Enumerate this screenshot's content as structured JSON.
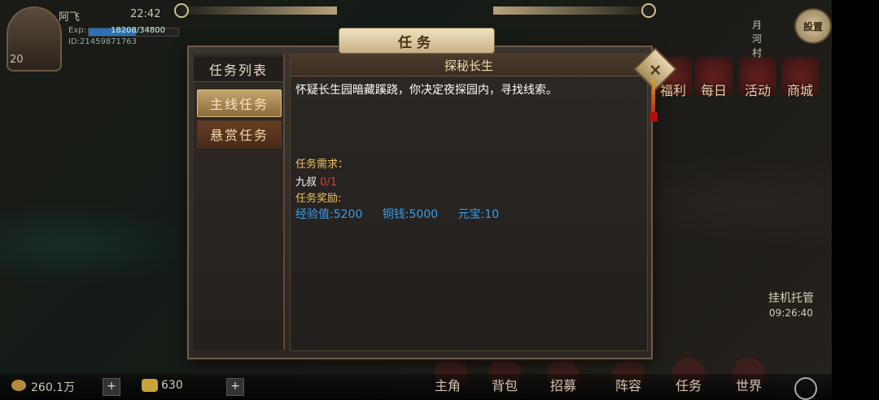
{
  "player": {
    "name": "阿飞",
    "time": "22:42",
    "exp_label": "Exp:",
    "exp_text": "18208/34800",
    "exp_fraction": 0.523,
    "id": "ID:21459871763",
    "level": "20"
  },
  "top_right": {
    "location": "月河村",
    "settings_label": "設置"
  },
  "side_menu": [
    "福利",
    "每日",
    "活动",
    "商城"
  ],
  "afk": {
    "label": "挂机托管",
    "time": "09:26:40"
  },
  "dialog": {
    "title": "任务",
    "list_header": "任务列表",
    "tabs": [
      {
        "label": "主线任务",
        "active": true
      },
      {
        "label": "悬赏任务",
        "active": false
      }
    ],
    "quest": {
      "name": "探秘长生",
      "description": "怀疑长生园暗藏蹊跷，你决定夜探园内，寻找线索。",
      "requirements_label": "任务需求：",
      "requirement_target": "九叔",
      "requirement_progress": "0/1",
      "rewards_label": "任务奖励:",
      "rewards": [
        "经验值:5200",
        "铜钱:5000",
        "元宝:10"
      ]
    }
  },
  "currency": {
    "copper": "260.1万",
    "ingot": "630"
  },
  "bottom_nav": [
    "主角",
    "背包",
    "招募",
    "阵容",
    "任务",
    "世界"
  ],
  "colors": {
    "reward_blue": "#3aa0ea",
    "label_gold": "#f0c060",
    "progress_red": "#e03a3a"
  }
}
